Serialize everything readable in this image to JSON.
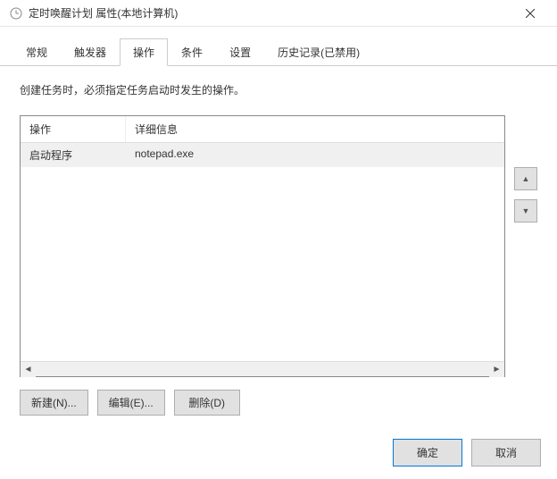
{
  "window": {
    "title": "定时唤醒计划 属性(本地计算机)"
  },
  "tabs": {
    "general": "常规",
    "triggers": "触发器",
    "actions": "操作",
    "conditions": "条件",
    "settings": "设置",
    "history": "历史记录(已禁用)"
  },
  "actions_tab": {
    "instruction": "创建任务时，必须指定任务启动时发生的操作。",
    "columns": {
      "operation": "操作",
      "details": "详细信息"
    },
    "rows": [
      {
        "operation": "启动程序",
        "details": "notepad.exe"
      }
    ],
    "buttons": {
      "new": "新建(N)...",
      "edit": "编辑(E)...",
      "delete": "删除(D)"
    },
    "side": {
      "up": "▲",
      "down": "▼"
    }
  },
  "dialog_buttons": {
    "ok": "确定",
    "cancel": "取消"
  }
}
